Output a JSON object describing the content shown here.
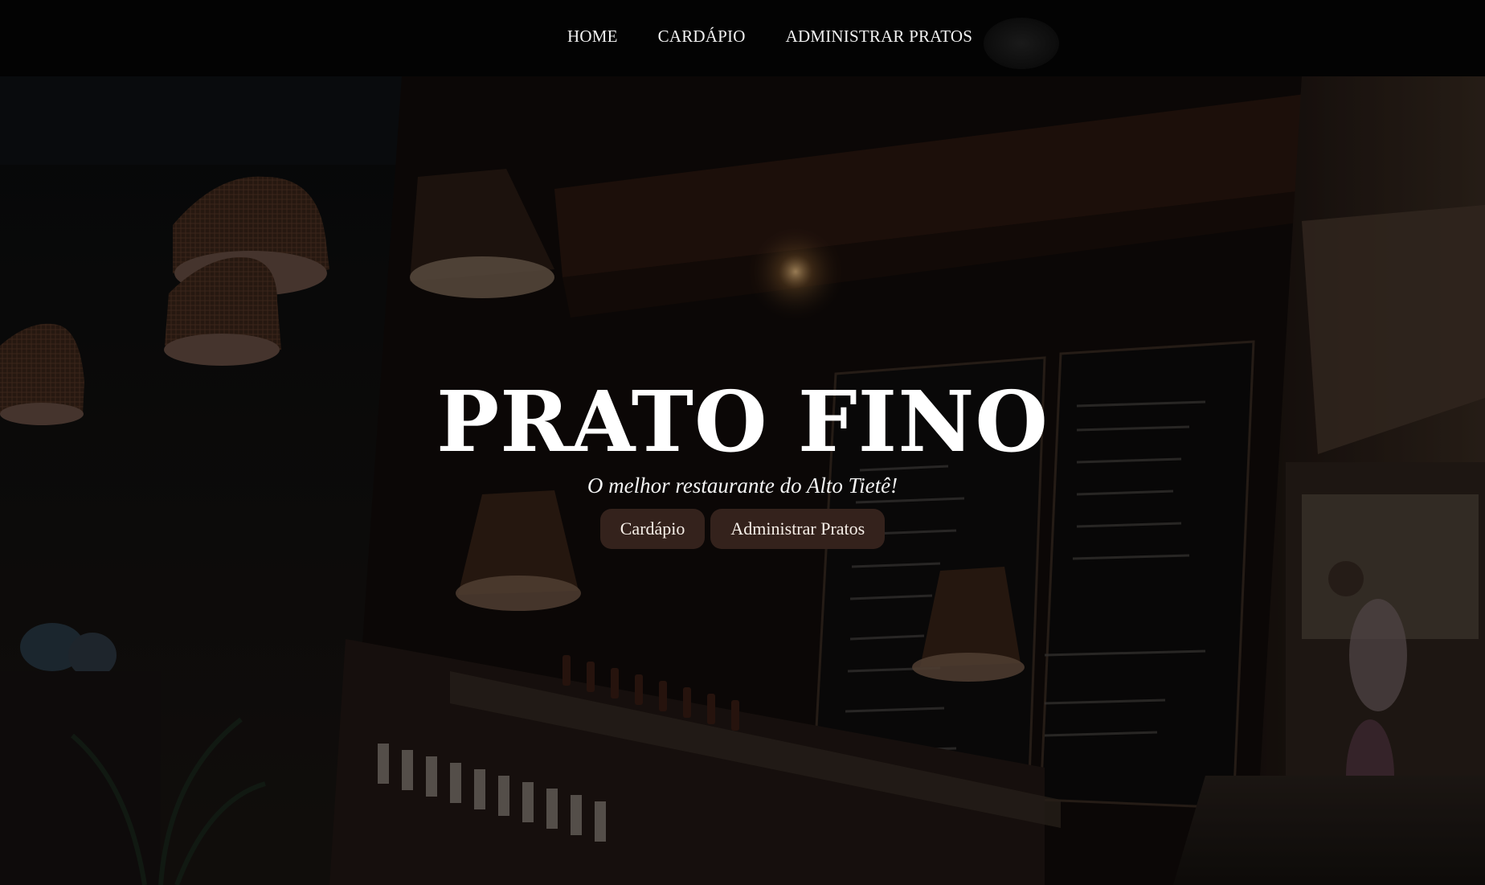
{
  "navbar": {
    "links": [
      {
        "label": "HOME"
      },
      {
        "label": "CARDÁPIO"
      },
      {
        "label": "ADMINISTRAR PRATOS"
      }
    ]
  },
  "hero": {
    "title": "PRATO FINO",
    "subtitle": "O melhor restaurante do Alto Tietê!",
    "buttons": [
      {
        "label": "Cardápio"
      },
      {
        "label": "Administrar Pratos"
      }
    ]
  },
  "colors": {
    "navbar_bg": "#030303",
    "button_bg": "#34221c",
    "text": "#ffffff"
  }
}
